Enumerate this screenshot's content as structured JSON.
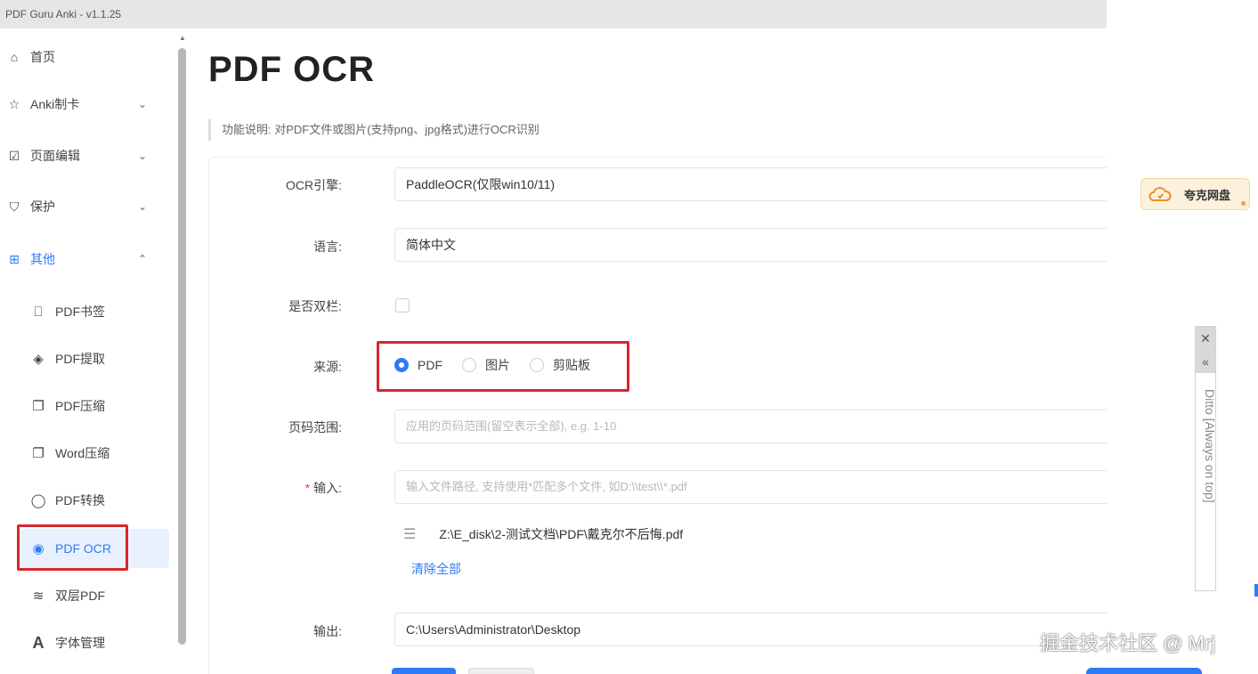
{
  "window": {
    "title": "PDF Guru Anki - v1.1.25"
  },
  "sidebar": {
    "items": [
      {
        "label": "首页",
        "icon": "home-icon"
      },
      {
        "label": "Anki制卡",
        "icon": "star-icon",
        "chevron": "⌄"
      },
      {
        "label": "页面编辑",
        "icon": "edit-icon",
        "chevron": "⌄"
      },
      {
        "label": "保护",
        "icon": "shield-icon",
        "chevron": "⌄"
      },
      {
        "label": "其他",
        "icon": "grid-icon",
        "chevron": "⌃"
      }
    ],
    "sub_items": [
      {
        "label": "PDF书签",
        "icon": "bookmark-icon"
      },
      {
        "label": "PDF提取",
        "icon": "extract-icon"
      },
      {
        "label": "PDF压缩",
        "icon": "compress-icon"
      },
      {
        "label": "Word压缩",
        "icon": "compress-icon"
      },
      {
        "label": "PDF转换",
        "icon": "convert-icon"
      },
      {
        "label": "PDF OCR",
        "icon": "eye-icon"
      },
      {
        "label": "双层PDF",
        "icon": "layers-icon"
      },
      {
        "label": "字体管理",
        "icon": "font-icon"
      }
    ]
  },
  "main": {
    "title": "PDF OCR",
    "description": "功能说明: 对PDF文件或图片(支持png、jpg格式)进行OCR识别",
    "form": {
      "engine_label": "OCR引擎:",
      "engine_value": "PaddleOCR(仅限win10/11)",
      "lang_label": "语言:",
      "lang_value": "简体中文",
      "double_col_label": "是否双栏:",
      "source_label": "来源:",
      "source_options": [
        "PDF",
        "图片",
        "剪贴板"
      ],
      "source_selected": "PDF",
      "page_range_label": "页码范围:",
      "page_range_placeholder": "应用的页码范围(留空表示全部), e.g. 1-10",
      "input_label": "输入:",
      "input_required": "*",
      "input_placeholder": "输入文件路径, 支持使用*匹配多个文件, 如D:\\\\test\\\\*.pdf",
      "file_item": "Z:\\E_disk\\2-测试文档\\PDF\\戴克尔不后悔.pdf",
      "clear_all": "清除全部",
      "output_label": "输出:",
      "output_value": "C:\\Users\\Administrator\\Desktop"
    }
  },
  "desktop": {
    "quark_label": "夸克网盘",
    "ditto_label": "Ditto [Always on top]",
    "ditto_close": "✕",
    "ditto_collapse": "«",
    "watermark": "掘金技术社区 @ Mrj"
  },
  "colors": {
    "accent": "#2f7bf6",
    "highlight_box": "#d9262c"
  }
}
